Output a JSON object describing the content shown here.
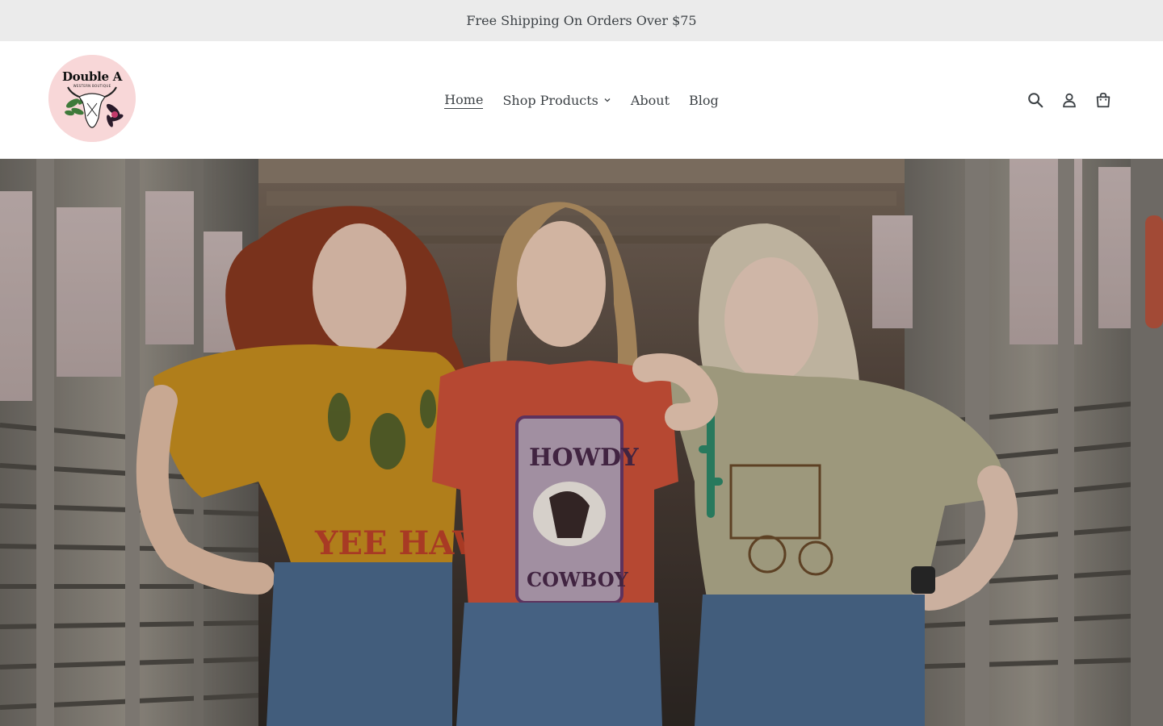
{
  "announcement": {
    "text": "Free Shipping On Orders Over $75"
  },
  "logo": {
    "title": "Double A",
    "subtitle": "WESTERN BOUTIQUE",
    "bg_color": "#f8d7d8"
  },
  "nav": {
    "items": [
      {
        "label": "Home",
        "active": true
      },
      {
        "label": "Shop Products",
        "has_dropdown": true,
        "icon": "chevron-down-icon"
      },
      {
        "label": "About"
      },
      {
        "label": "Blog"
      }
    ]
  },
  "header_icons": {
    "search": "search-icon",
    "account": "account-icon",
    "cart": "cart-icon"
  },
  "hero": {
    "shirt_texts": [
      "YEE HAW",
      "HOWDY",
      "COWBOY"
    ],
    "colors": {
      "mustard": "#c9901f",
      "rust": "#d0523a",
      "sage": "#b3ad8e",
      "denim": "#4c6a8e"
    }
  }
}
